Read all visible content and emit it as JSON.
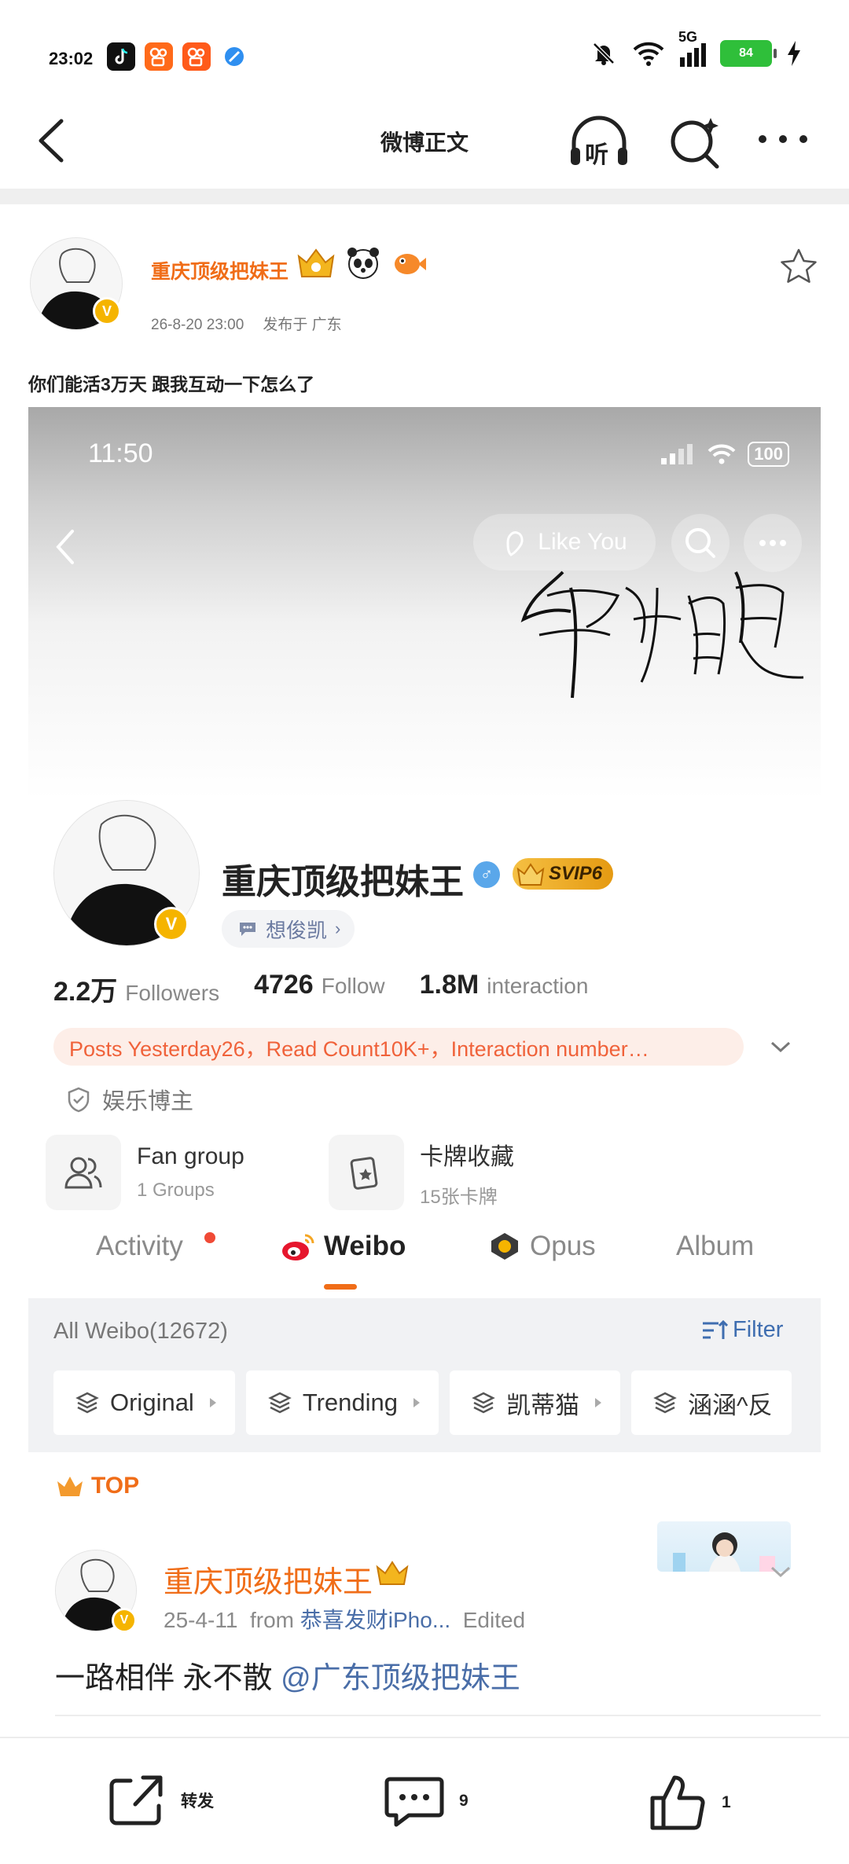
{
  "status_bar": {
    "time": "23:02",
    "network": "5G",
    "battery": "84",
    "apps": [
      "tiktok-icon",
      "kuaishou-icon",
      "kuaishou-lite-icon",
      "browser-icon"
    ]
  },
  "nav": {
    "title": "微博正文",
    "listen_label": "听"
  },
  "post": {
    "author": "重庆顶级把妹王",
    "date": "26-8-20 23:00",
    "location": "发布于 广东",
    "text": "你们能活3万天 跟我互动一下怎么了"
  },
  "screenshot": {
    "time": "11:50",
    "battery": "100",
    "like_you": "Like You",
    "calligraphy_alt": "常相见",
    "profile": {
      "name": "重庆顶级把妹王",
      "svip": "SVIP6",
      "super_topic": "想俊凯",
      "followers_value": "2.2万",
      "followers_label": "Followers",
      "follow_value": "4726",
      "follow_label": "Follow",
      "interaction_value": "1.8M",
      "interaction_label": "interaction",
      "summary": "Posts Yesterday26，Read Count10K+，Interaction number…",
      "identity": "娱乐博主"
    },
    "tiles": [
      {
        "title": "Fan group",
        "sub": "1 Groups"
      },
      {
        "title": "卡牌收藏",
        "sub": "15张卡牌"
      }
    ],
    "tabs": [
      "Activity",
      "Weibo",
      "Opus",
      "Album"
    ],
    "all_weibo": "All Weibo(12672)",
    "filter": "Filter",
    "chips": [
      "Original",
      "Trending",
      "凯蒂猫",
      "涵涵^反"
    ],
    "top_label": "TOP",
    "item": {
      "author": "重庆顶级把妹王",
      "date": "25-4-11",
      "from_label": "from",
      "source": "恭喜发财iPho...",
      "edited": "Edited",
      "text": "一路相伴 永不散 ",
      "mention": "@广东顶级把妹王"
    }
  },
  "actions": {
    "repost": "转发",
    "comments": "9",
    "likes": "1"
  },
  "colors": {
    "accent": "#f06d18",
    "link": "#4a6ea8",
    "summary_bg": "#fdeee8",
    "summary_text": "#f0623a"
  }
}
